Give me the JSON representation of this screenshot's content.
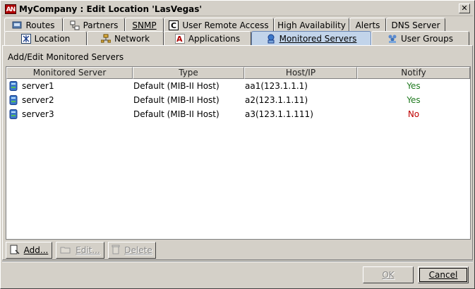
{
  "window": {
    "app_icon_text": "AN",
    "title": "MyCompany : Edit Location 'LasVegas'",
    "close_glyph": "✕"
  },
  "tabs_row1": [
    {
      "label": "Routes",
      "icon": "routes-icon"
    },
    {
      "label": "Partners",
      "icon": "partners-icon"
    },
    {
      "label": "SNMP",
      "icon": ""
    },
    {
      "label": "User Remote Access",
      "icon": "c-icon"
    },
    {
      "label": "High Availability",
      "icon": ""
    },
    {
      "label": "Alerts",
      "icon": ""
    },
    {
      "label": "DNS Server",
      "icon": ""
    }
  ],
  "tabs_row2": [
    {
      "label": "Location",
      "icon": "location-icon"
    },
    {
      "label": "Network",
      "icon": "network-icon"
    },
    {
      "label": "Applications",
      "icon": "applications-icon"
    },
    {
      "label": "Monitored Servers",
      "icon": "monitored-servers-icon",
      "selected": true
    },
    {
      "label": "User Groups",
      "icon": "user-groups-icon"
    }
  ],
  "section": {
    "label": "Add/Edit Monitored Servers"
  },
  "table": {
    "columns": [
      "Monitored Server",
      "Type",
      "Host/IP",
      "Notify"
    ],
    "rows": [
      {
        "server": "server1",
        "type": "Default (MIB-II Host)",
        "host": "aa1(123.1.1.1)",
        "notify": "Yes"
      },
      {
        "server": "server2",
        "type": "Default (MIB-II Host)",
        "host": "a2(123.1.1.11)",
        "notify": "Yes"
      },
      {
        "server": "server3",
        "type": "Default (MIB-II Host)",
        "host": "a3(123.1.1.111)",
        "notify": "No"
      }
    ]
  },
  "actions": {
    "add": "Add...",
    "edit": "Edit...",
    "delete": "Delete"
  },
  "footer": {
    "ok": "OK",
    "cancel": "Cancel"
  },
  "colors": {
    "background": "#d4d0c8",
    "selected_tab": "#c2d4ea",
    "notify_yes": "#1f7a1f",
    "notify_no": "#c00000"
  }
}
